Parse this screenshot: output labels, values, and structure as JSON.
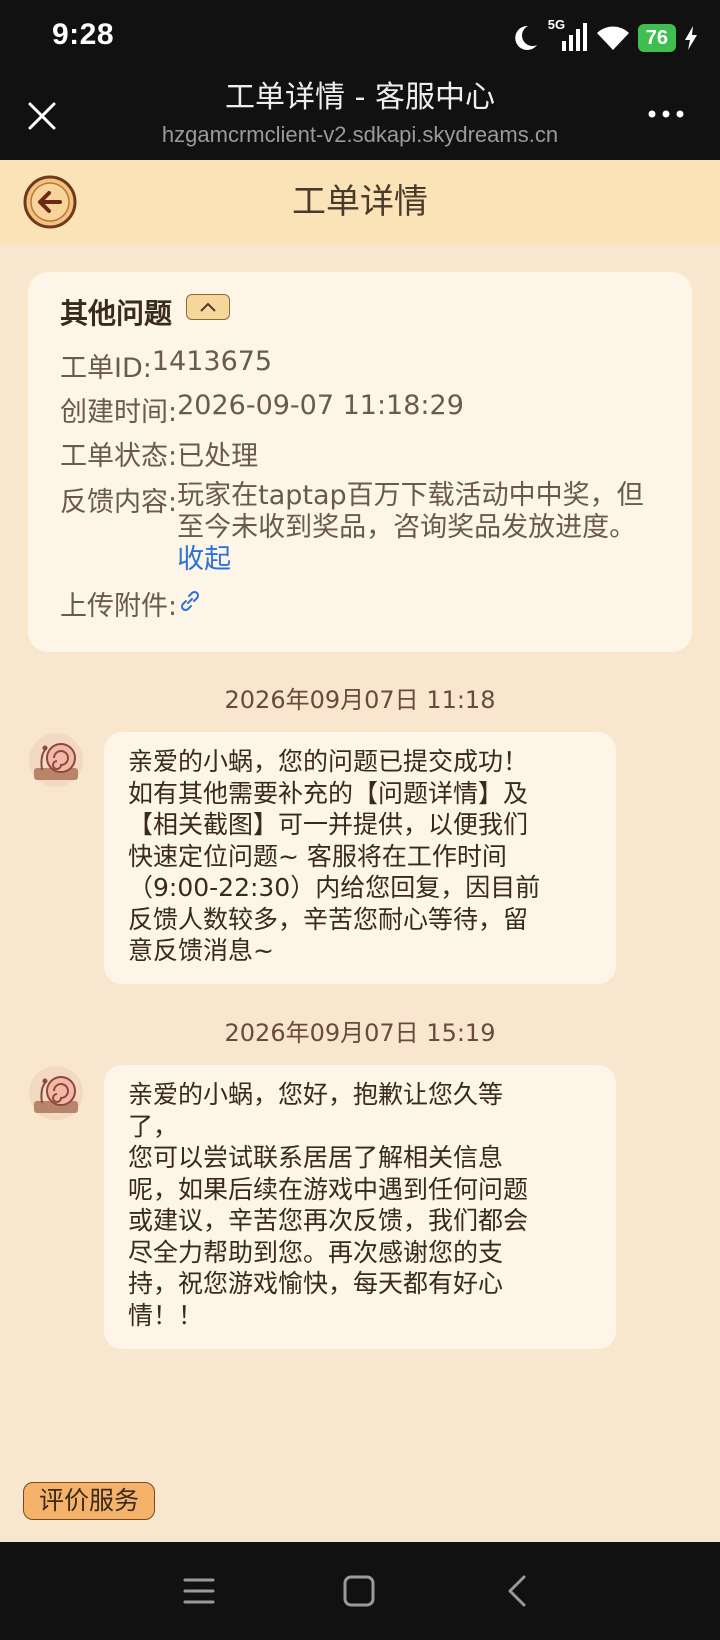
{
  "status_bar": {
    "time": "9:28",
    "network": "5G",
    "battery": "76"
  },
  "title_bar": {
    "title": "工单详情 - 客服中心",
    "url": "hzgamcrmclient-v2.sdkapi.skydreams.cn"
  },
  "header": {
    "title": "工单详情"
  },
  "ticket": {
    "category": "其他问题",
    "id_label": "工单ID: ",
    "id_value": "1413675",
    "created_label": "创建时间: ",
    "created_value": "2026-09-07 11:18:29",
    "status_label": "工单状态: ",
    "status_value": "已处理",
    "content_label": "反馈内容: ",
    "content_value": "玩家在taptap百万下载活动中中奖，但至今未收到奖品，咨询奖品发放进度。",
    "collapse_link": "收起",
    "attachment_label": "上传附件: "
  },
  "messages": [
    {
      "timestamp": "2026年09月07日 11:18",
      "text": "亲爱的小蜗，您的问题已提交成功！\n如有其他需要补充的【问题详情】及\n【相关截图】可一并提供，以便我们\n快速定位问题~  客服将在工作时间\n（9:00-22:30）内给您回复，因目前\n反馈人数较多，辛苦您耐心等待，留\n意反馈消息~"
    },
    {
      "timestamp": "2026年09月07日 15:19",
      "text": "亲爱的小蜗，您好，抱歉让您久等\n了，\n您可以尝试联系居居了解相关信息\n呢，如果后续在游戏中遇到任何问题\n或建议，辛苦您再次反馈，我们都会\n尽全力帮助到您。再次感谢您的支\n持，祝您游戏愉快，每天都有好心\n情！！"
    }
  ],
  "rate_button": "评价服务",
  "icons": {
    "close": "close-icon",
    "more": "more-icon",
    "back": "back-arrow-icon",
    "chevron": "chevron-up-icon",
    "link": "link-icon",
    "avatar": "snail-avatar-icon",
    "nav_menu": "menu-icon",
    "nav_home": "home-square-icon",
    "nav_back": "back-chevron-icon"
  },
  "colors": {
    "page_bg": "#f8e6cf",
    "header_bg": "#fbe3b8",
    "card_bg": "#fdf5e8",
    "link": "#2b72d8",
    "rate_button": "#f4b26a",
    "battery": "#3fbf4f"
  }
}
